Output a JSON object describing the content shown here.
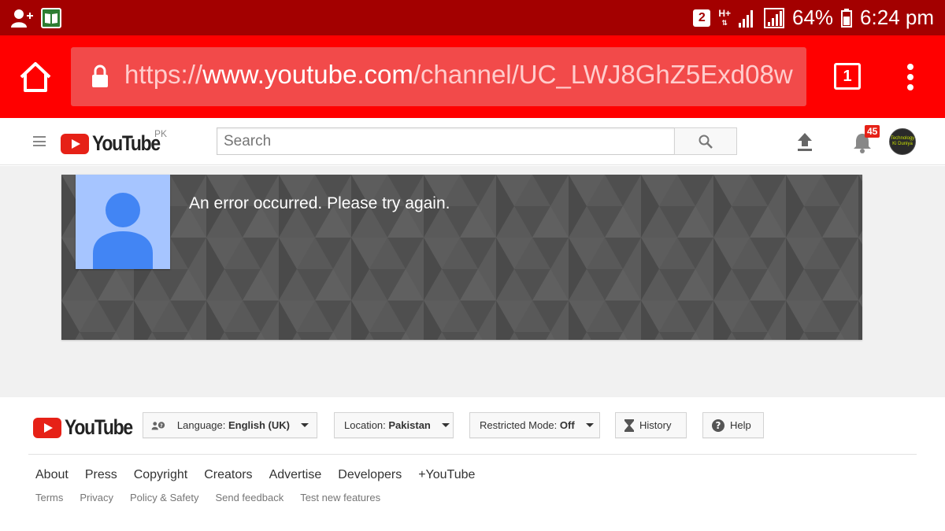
{
  "status_bar": {
    "sim_number": "2",
    "network_type": "H+",
    "battery": "64%",
    "time": "6:24 pm"
  },
  "browser": {
    "url_scheme": "https://",
    "url_domain": "www.youtube.com",
    "url_path": "/channel/UC_LWJ8GhZ5Exd08w",
    "tab_count": "1"
  },
  "header": {
    "logo_text": "YouTube",
    "country_code": "PK",
    "search_placeholder": "Search",
    "notification_count": "45",
    "avatar_line1": "Technology",
    "avatar_line2": "Ki Duniya"
  },
  "channel": {
    "error_message": "An error occurred. Please try again."
  },
  "footer": {
    "logo_text": "YouTube",
    "language_label": "Language:",
    "language_value": "English (UK)",
    "location_label": "Location:",
    "location_value": "Pakistan",
    "restricted_label": "Restricted Mode:",
    "restricted_value": "Off",
    "history_label": "History",
    "help_label": "Help",
    "links": [
      "About",
      "Press",
      "Copyright",
      "Creators",
      "Advertise",
      "Developers",
      "+YouTube"
    ],
    "sublinks": [
      "Terms",
      "Privacy",
      "Policy & Safety",
      "Send feedback",
      "Test new features"
    ]
  },
  "colors": {
    "status_bar": "#a30000",
    "browser_bar": "#ff0000",
    "youtube_red": "#e62117",
    "banner_grey": "#555555",
    "avatar_bg": "#a6c5ff",
    "avatar_figure": "#4285f4"
  }
}
